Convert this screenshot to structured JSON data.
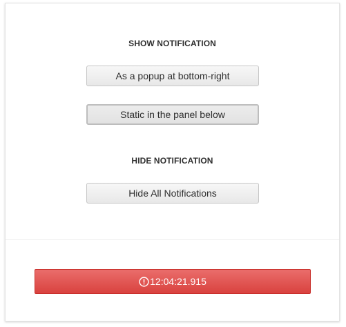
{
  "show_section": {
    "title": "SHOW NOTIFICATION",
    "popup_button": "As a popup at bottom-right",
    "static_button": "Static in the panel below"
  },
  "hide_section": {
    "title": "HIDE NOTIFICATION",
    "hide_all_button": "Hide All Notifications"
  },
  "notification": {
    "icon": "alert-circle-icon",
    "time": "12:04:21.915",
    "color": "#e05553"
  }
}
